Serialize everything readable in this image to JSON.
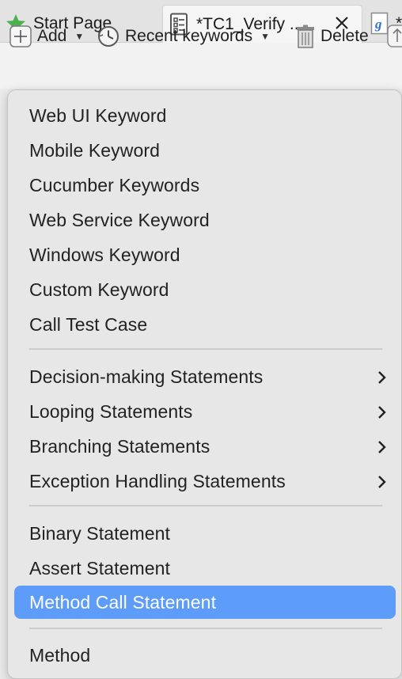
{
  "tabs": [
    {
      "label": "Start Page",
      "icon": "star-icon"
    },
    {
      "label": "*TC1_Verify ...",
      "icon": "test-case-icon",
      "active": true
    },
    {
      "label": "*",
      "icon": "groovy-file-icon"
    }
  ],
  "toolbar": {
    "add_label": "Add",
    "recent_label": "Recent keywords",
    "delete_label": "Delete"
  },
  "menu": {
    "groups": [
      [
        "Web UI Keyword",
        "Mobile Keyword",
        "Cucumber Keywords",
        "Web Service Keyword",
        "Windows Keyword",
        "Custom Keyword",
        "Call Test Case"
      ],
      [
        "Decision-making Statements",
        "Looping Statements",
        "Branching Statements",
        "Exception Handling Statements"
      ],
      [
        "Binary Statement",
        "Assert Statement",
        "Method Call Statement"
      ],
      [
        "Method"
      ]
    ],
    "selected": "Method Call Statement"
  },
  "colors": {
    "selection": "#5d9cf8",
    "star": "#4caf50",
    "groovy": "#2f6fd6"
  }
}
